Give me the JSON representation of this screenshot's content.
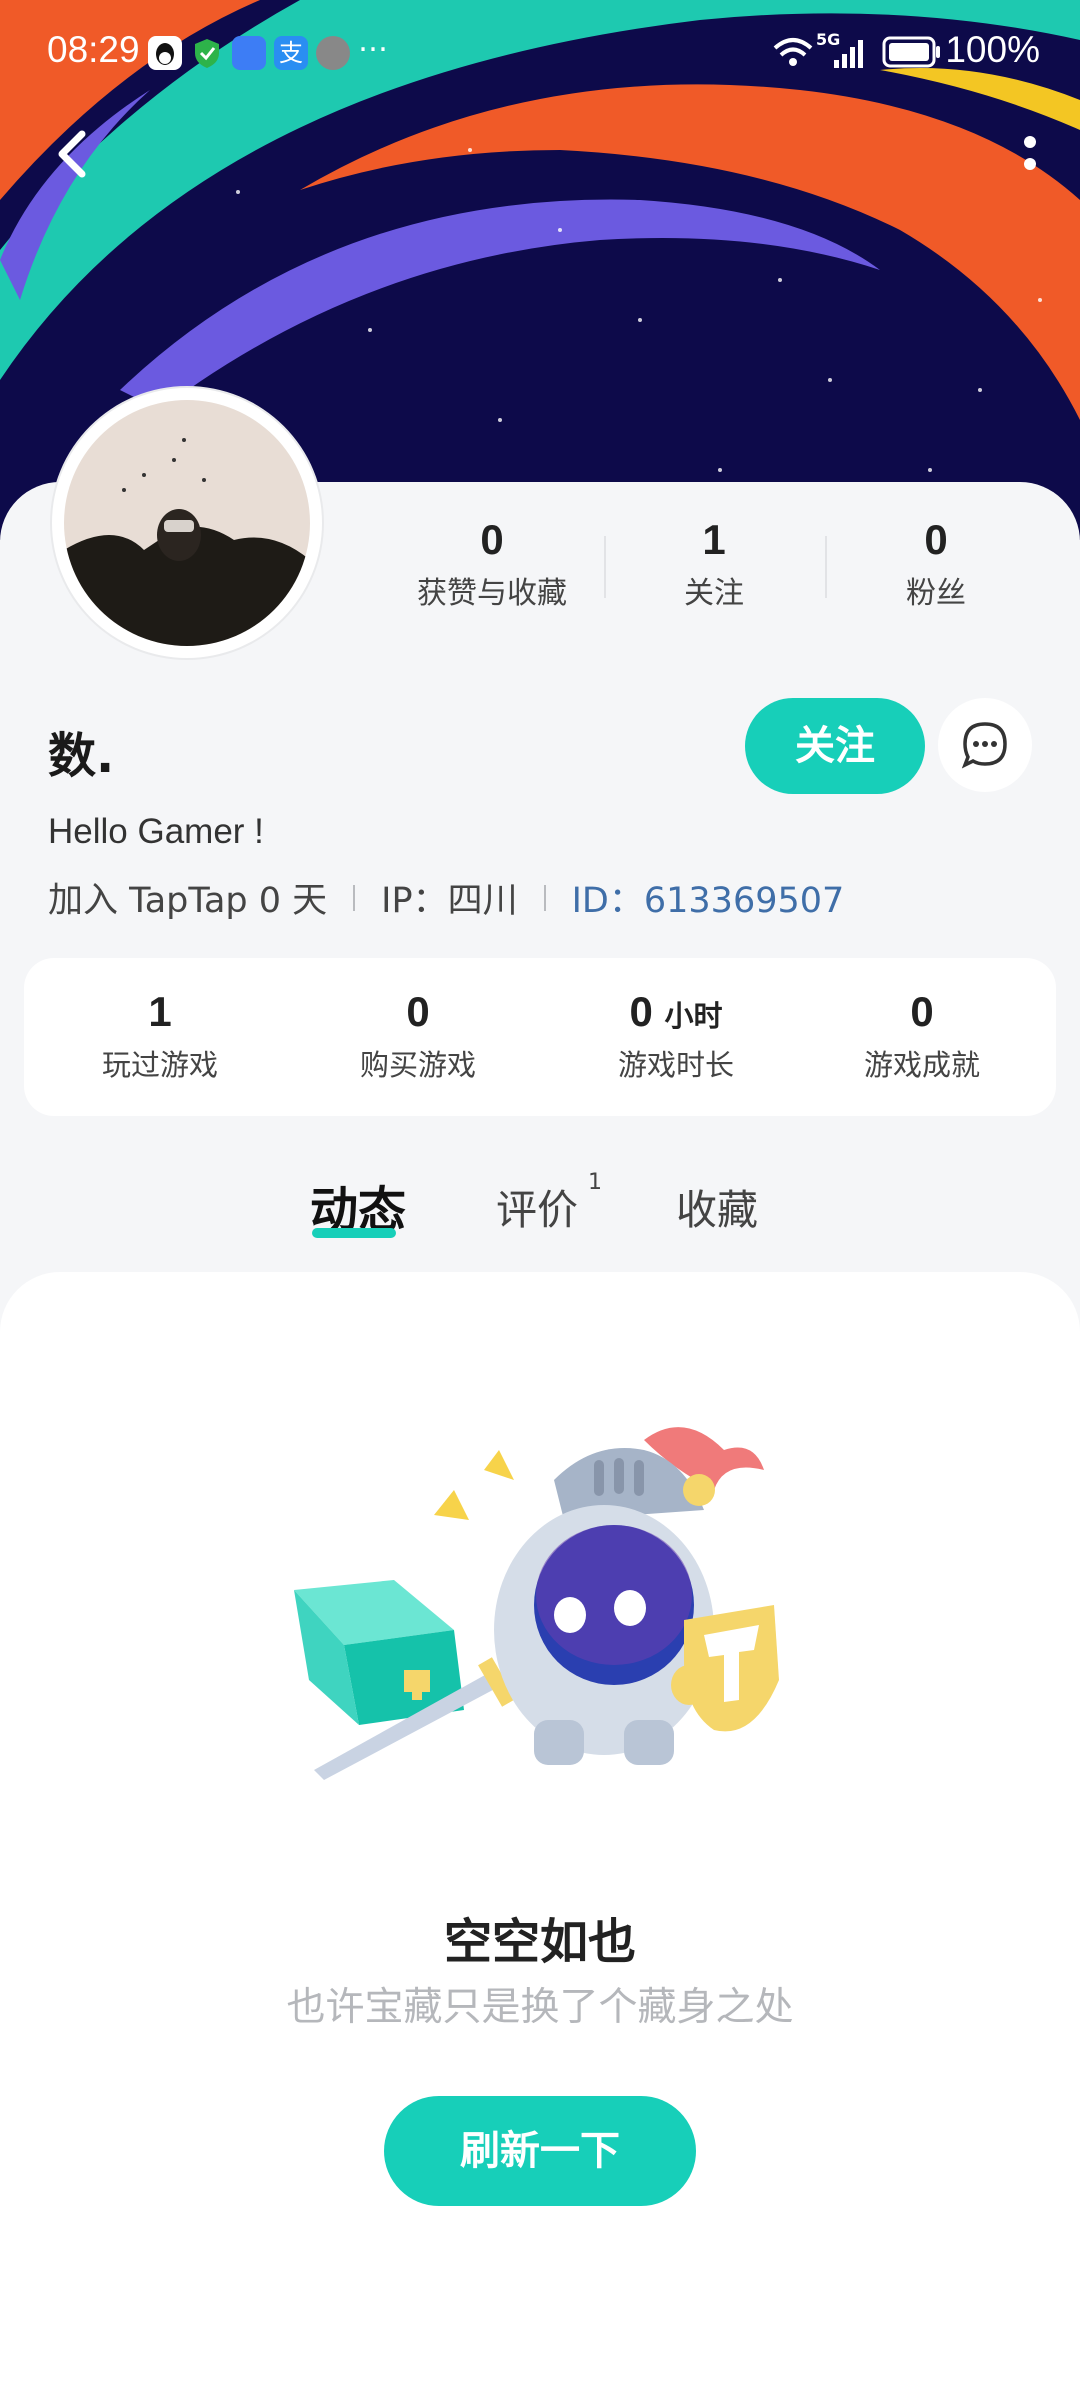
{
  "status_bar": {
    "time": "08:29",
    "network": "5G",
    "battery": "100%",
    "more_glyph": "…"
  },
  "colors": {
    "accent": "#17cfb9",
    "banner_bg": "#0d0a4a",
    "id_blue": "#3f6ea8"
  },
  "profile": {
    "username": "数.",
    "bio": "Hello Gamer !",
    "joined": "加入 TapTap 0 天",
    "ip": "IP：四川",
    "id": "ID：613369507",
    "follow_label": "关注",
    "social_stats": [
      {
        "value": "0",
        "label": "获赞与收藏"
      },
      {
        "value": "1",
        "label": "关注"
      },
      {
        "value": "0",
        "label": "粉丝"
      }
    ]
  },
  "game_stats": [
    {
      "value": "1",
      "unit": "",
      "label": "玩过游戏"
    },
    {
      "value": "0",
      "unit": "",
      "label": "购买游戏"
    },
    {
      "value": "0",
      "unit": "小时",
      "label": "游戏时长"
    },
    {
      "value": "0",
      "unit": "",
      "label": "游戏成就"
    }
  ],
  "tabs": [
    {
      "label": "动态",
      "badge": ""
    },
    {
      "label": "评价",
      "badge": "1"
    },
    {
      "label": "收藏",
      "badge": ""
    }
  ],
  "empty_state": {
    "title": "空空如也",
    "subtitle": "也许宝藏只是换了个藏身之处",
    "button": "刷新一下"
  }
}
